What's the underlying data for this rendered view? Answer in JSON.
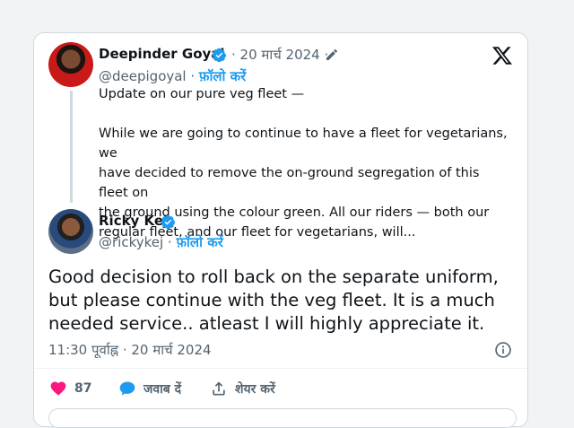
{
  "quoted_tweet": {
    "author_name": "Deepinder Goyal",
    "date": "· 20 मार्च 2024 ·",
    "handle": "@deepigoyal ·",
    "follow_label": "फ़ॉलो करें",
    "text_lines": [
      "Update on our pure veg fleet —",
      "",
      "While we are going to continue to have a fleet for vegetarians, we",
      "have decided to remove the on-ground segregation of this fleet on",
      "the ground using the colour green. All our riders — both our",
      "regular fleet, and our fleet for vegetarians, will..."
    ]
  },
  "reply_tweet": {
    "author_name": "Ricky Kej",
    "handle": "@rickykej ·",
    "follow_label": "फ़ॉलो करें",
    "text": "Good decision to roll back on the separate uniform, but please continue with the veg fleet. It is a much needed service..  atleast I will highly appreciate it.",
    "timestamp": "11:30 पूर्वाह्न · 20 मार्च 2024"
  },
  "actions": {
    "like_count": "87",
    "reply_label": "जवाब दें",
    "share_label": "शेयर करें"
  },
  "colors": {
    "accent": "#1d9bf0",
    "like": "#f91880",
    "muted": "#536471"
  },
  "icons": [
    "x-logo-icon",
    "verified-badge-icon",
    "pencil-icon",
    "info-icon",
    "heart-icon",
    "reply-bubble-icon",
    "share-icon"
  ]
}
